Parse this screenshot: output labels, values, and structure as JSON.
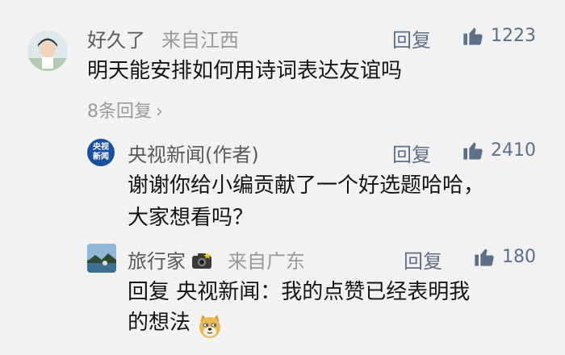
{
  "comments": [
    {
      "name": "好久了",
      "location": "来自江西",
      "reply_label": "回复",
      "likes": "1223",
      "text_lines": [
        "明天能安排如何用诗词表达友谊吗"
      ],
      "expand_label": "8条回复"
    },
    {
      "name": "央视新闻(作者)",
      "reply_label": "回复",
      "likes": "2410",
      "avatar_lines": [
        "央视",
        "新闻"
      ],
      "text_lines": [
        "谢谢你给小编贡献了一个好选题哈哈，",
        "大家想看吗？"
      ]
    },
    {
      "name": "旅行家",
      "location": "来自广东",
      "reply_label": "回复",
      "likes": "180",
      "text_lines": [
        "回复 央视新闻：我的点赞已经表明我",
        "的想法"
      ]
    }
  ],
  "icons": {
    "like": "thumbs-up-icon",
    "expand": "chevron-right-icon",
    "camera": "camera-emoji-icon",
    "dog": "doge-emoji-icon"
  },
  "colors": {
    "background": "#f2f2f2",
    "action": "#5e6f87",
    "cctv_blue": "#1a4f9c",
    "text": "#141414",
    "muted": "#9a9a9a"
  }
}
